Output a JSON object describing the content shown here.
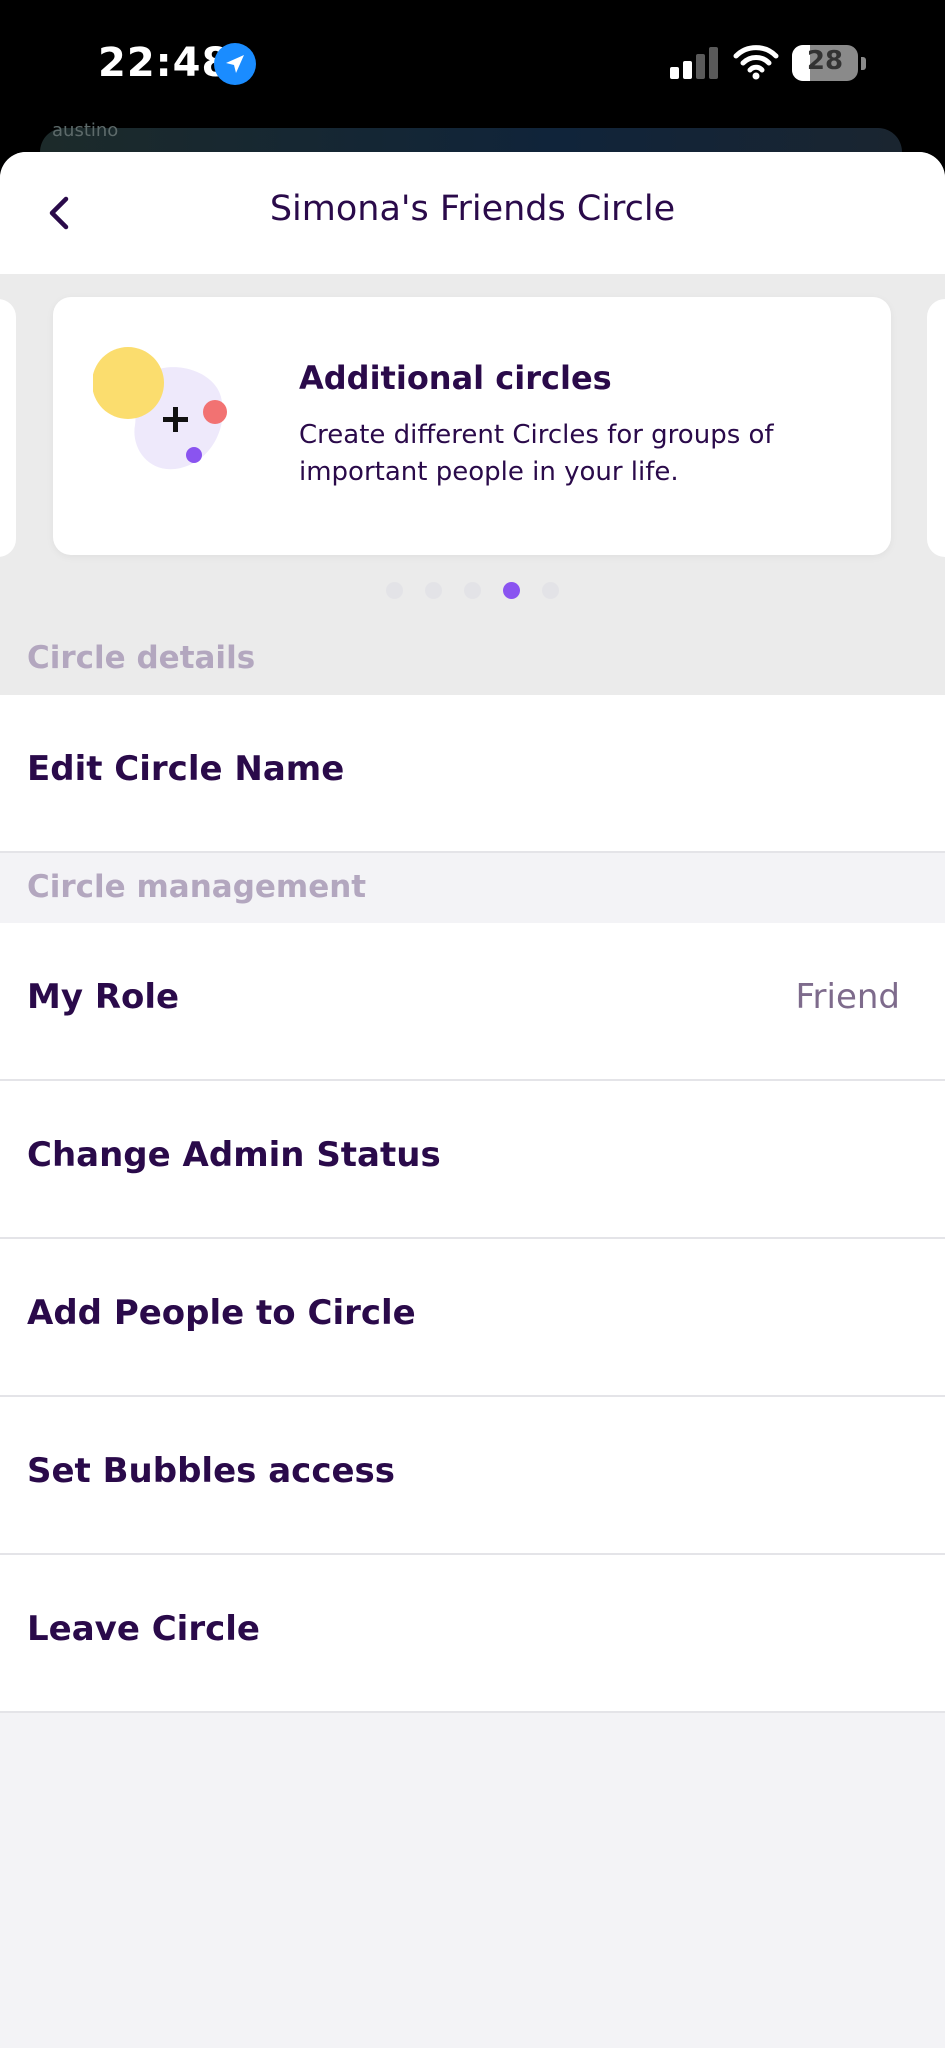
{
  "status_bar": {
    "time": "22:48",
    "battery": "28",
    "battery_level": 0.28
  },
  "map_peek": {
    "text": "austino"
  },
  "header": {
    "title": "Simona's Friends Circle",
    "back_icon": "chevron-left-icon"
  },
  "promo": {
    "title": "Additional circles",
    "description": "Create different Circles for groups of important people in your life.",
    "page_count": 5,
    "active_page": 4
  },
  "sections": {
    "details_label": "Circle details",
    "management_label": "Circle management"
  },
  "rows": {
    "edit_name": "Edit Circle Name",
    "my_role": "My Role",
    "my_role_value": "Friend",
    "change_admin": "Change Admin Status",
    "add_people": "Add People to Circle",
    "bubbles": "Set Bubbles access",
    "leave": "Leave Circle"
  },
  "colors": {
    "primary_text": "#2a0a4a",
    "section_label": "#b3a7bf",
    "accent": "#8a54f0",
    "illustration_yellow": "#fbdd6e",
    "illustration_coral": "#f27272",
    "illustration_blob": "#eee9fb"
  }
}
